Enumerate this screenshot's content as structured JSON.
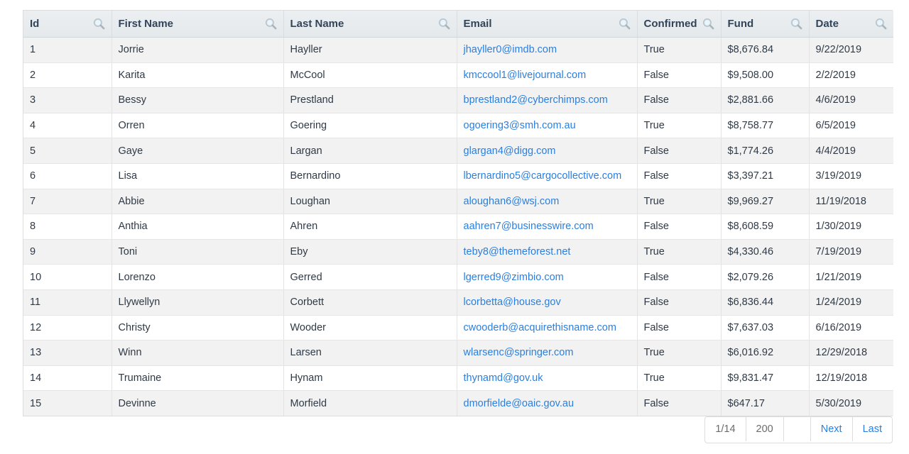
{
  "table": {
    "columns": [
      {
        "label": "Id",
        "key": "id",
        "icon": "search-icon"
      },
      {
        "label": "First Name",
        "key": "first",
        "icon": "search-icon"
      },
      {
        "label": "Last Name",
        "key": "last",
        "icon": "search-icon"
      },
      {
        "label": "Email",
        "key": "email",
        "icon": "search-icon"
      },
      {
        "label": "Confirmed",
        "key": "confirmed",
        "icon": "search-icon"
      },
      {
        "label": "Fund",
        "key": "fund",
        "icon": "search-icon"
      },
      {
        "label": "Date",
        "key": "date",
        "icon": "search-icon"
      }
    ],
    "rows": [
      {
        "id": "1",
        "first": "Jorrie",
        "last": "Hayller",
        "email": "jhayller0@imdb.com",
        "confirmed": "True",
        "fund": "$8,676.84",
        "date": "9/22/2019"
      },
      {
        "id": "2",
        "first": "Karita",
        "last": "McCool",
        "email": "kmccool1@livejournal.com",
        "confirmed": "False",
        "fund": "$9,508.00",
        "date": "2/2/2019"
      },
      {
        "id": "3",
        "first": "Bessy",
        "last": "Prestland",
        "email": "bprestland2@cyberchimps.com",
        "confirmed": "False",
        "fund": "$2,881.66",
        "date": "4/6/2019"
      },
      {
        "id": "4",
        "first": "Orren",
        "last": "Goering",
        "email": "ogoering3@smh.com.au",
        "confirmed": "True",
        "fund": "$8,758.77",
        "date": "6/5/2019"
      },
      {
        "id": "5",
        "first": "Gaye",
        "last": "Largan",
        "email": "glargan4@digg.com",
        "confirmed": "False",
        "fund": "$1,774.26",
        "date": "4/4/2019"
      },
      {
        "id": "6",
        "first": "Lisa",
        "last": "Bernardino",
        "email": "lbernardino5@cargocollective.com",
        "confirmed": "False",
        "fund": "$3,397.21",
        "date": "3/19/2019"
      },
      {
        "id": "7",
        "first": "Abbie",
        "last": "Loughan",
        "email": "aloughan6@wsj.com",
        "confirmed": "True",
        "fund": "$9,969.27",
        "date": "11/19/2018"
      },
      {
        "id": "8",
        "first": "Anthia",
        "last": "Ahren",
        "email": "aahren7@businesswire.com",
        "confirmed": "False",
        "fund": "$8,608.59",
        "date": "1/30/2019"
      },
      {
        "id": "9",
        "first": "Toni",
        "last": "Eby",
        "email": "teby8@themeforest.net",
        "confirmed": "True",
        "fund": "$4,330.46",
        "date": "7/19/2019"
      },
      {
        "id": "10",
        "first": "Lorenzo",
        "last": "Gerred",
        "email": "lgerred9@zimbio.com",
        "confirmed": "False",
        "fund": "$2,079.26",
        "date": "1/21/2019"
      },
      {
        "id": "11",
        "first": "Llywellyn",
        "last": "Corbett",
        "email": "lcorbetta@house.gov",
        "confirmed": "False",
        "fund": "$6,836.44",
        "date": "1/24/2019"
      },
      {
        "id": "12",
        "first": "Christy",
        "last": "Wooder",
        "email": "cwooderb@acquirethisname.com",
        "confirmed": "False",
        "fund": "$7,637.03",
        "date": "6/16/2019"
      },
      {
        "id": "13",
        "first": "Winn",
        "last": "Larsen",
        "email": "wlarsenc@springer.com",
        "confirmed": "True",
        "fund": "$6,016.92",
        "date": "12/29/2018"
      },
      {
        "id": "14",
        "first": "Trumaine",
        "last": "Hynam",
        "email": "thynamd@gov.uk",
        "confirmed": "True",
        "fund": "$9,831.47",
        "date": "12/19/2018"
      },
      {
        "id": "15",
        "first": "Devinne",
        "last": "Morfield",
        "email": "dmorfielde@oaic.gov.au",
        "confirmed": "False",
        "fund": "$647.17",
        "date": "5/30/2019"
      }
    ]
  },
  "pager": {
    "page_indicator": "1/14",
    "page_size": "200",
    "blank": "",
    "next_label": "Next",
    "last_label": "Last"
  },
  "colors": {
    "link": "#2a7fe0",
    "header_bg": "#e8ecef",
    "stripe": "#f2f2f2",
    "border": "#dcdcdc",
    "text": "#2f3a46"
  }
}
